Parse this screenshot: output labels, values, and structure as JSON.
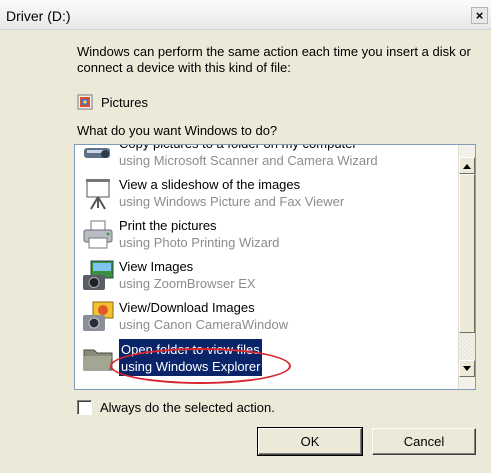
{
  "window": {
    "title": "Driver (D:)",
    "close_label": "×"
  },
  "description": "Windows can perform the same action each time you insert a disk or connect a device with this kind of file:",
  "content_type": {
    "label": "Pictures",
    "icon": "pictures-icon"
  },
  "question": "What do you want Windows to do?",
  "actions": [
    {
      "title": "Copy pictures to a folder on my computer",
      "subtitle": "using Microsoft Scanner and Camera Wizard",
      "icon": "scanner-camera-icon",
      "selected": false
    },
    {
      "title": "View a slideshow of the images",
      "subtitle": "using Windows Picture and Fax Viewer",
      "icon": "slideshow-projector-icon",
      "selected": false
    },
    {
      "title": "Print the pictures",
      "subtitle": "using Photo Printing Wizard",
      "icon": "printer-icon",
      "selected": false
    },
    {
      "title": "View Images",
      "subtitle": "using ZoomBrowser EX",
      "icon": "zoombrowser-icon",
      "selected": false
    },
    {
      "title": "View/Download Images",
      "subtitle": "using Canon CameraWindow",
      "icon": "camerawindow-icon",
      "selected": false
    },
    {
      "title": "Open folder to view files",
      "subtitle": "using Windows Explorer",
      "icon": "folder-icon",
      "selected": true
    }
  ],
  "always_checkbox": {
    "label": "Always do the selected action.",
    "checked": false
  },
  "buttons": {
    "ok": "OK",
    "cancel": "Cancel"
  },
  "colors": {
    "selection_bg": "#0a246a",
    "annotation_ring": "#d9262c"
  }
}
